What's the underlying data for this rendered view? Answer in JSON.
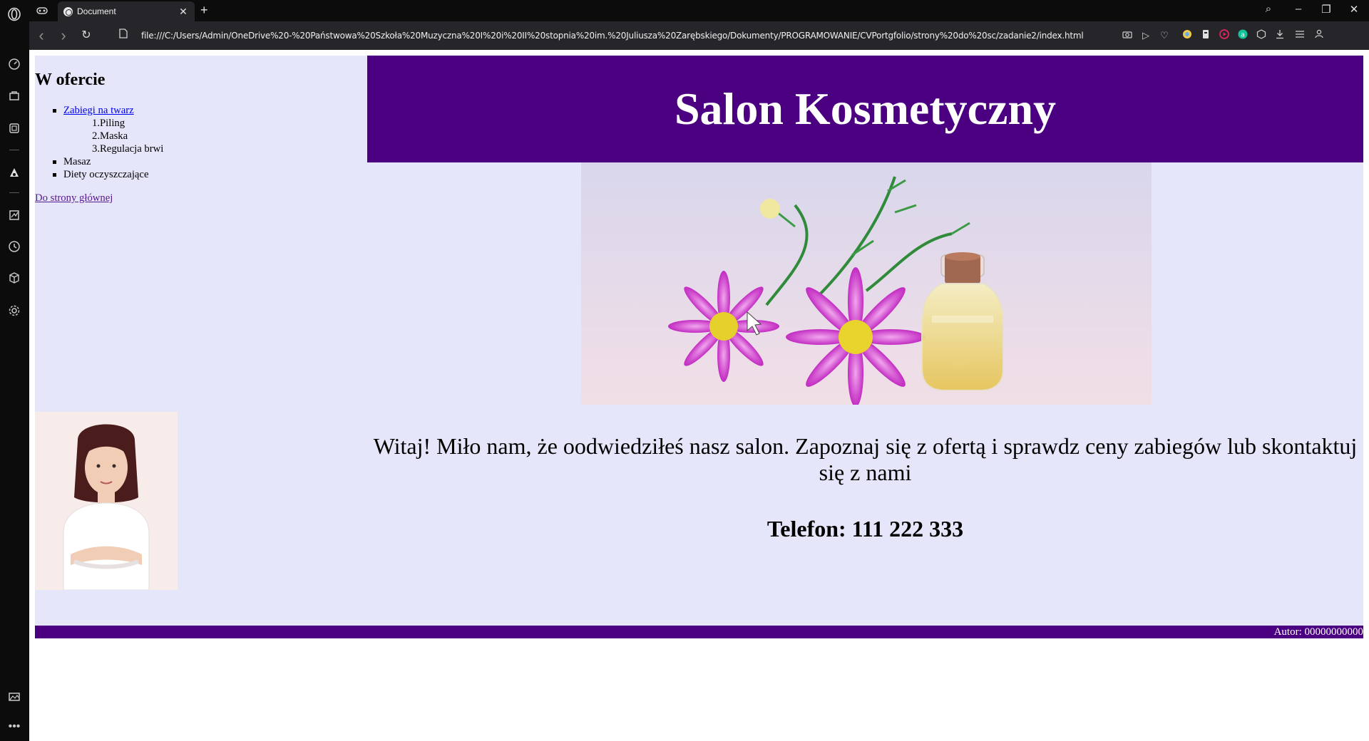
{
  "browser": {
    "tab_title": "Document",
    "tab_close": "✕",
    "new_tab": "+",
    "url": "file:///C:/Users/Admin/OneDrive%20-%20Państwowa%20Szkoła%20Muzyczna%20I%20i%20II%20stopnia%20im.%20Juliusza%20Zarębskiego/Dokumenty/PROGRAMOWANIE/CVPortgfolio/strony%20do%20sc/zadanie2/index.html",
    "back": "‹",
    "forward": "›",
    "reload": "↻",
    "win_search": "⌕",
    "win_minimize": "–",
    "win_restore": "❐",
    "win_close": "✕"
  },
  "colors": {
    "page_bg": "#e6e6fa",
    "header_bg": "#4b0082",
    "footer_bg": "#4b0082",
    "link": "#0000ee",
    "visited_link": "#551a8b"
  },
  "aside": {
    "heading": "W ofercie",
    "items": [
      {
        "label": "Zabiegi na twarz",
        "link": true
      },
      {
        "label": "Masaz",
        "link": false
      },
      {
        "label": "Diety oczyszczające",
        "link": false
      }
    ],
    "subitems": [
      "1.Piling",
      "2.Maska",
      "3.Regulacja brwi"
    ],
    "home_link": "Do strony głównej"
  },
  "header": {
    "title": "Salon Kosmetyczny"
  },
  "main": {
    "welcome": "Witaj! Miło nam, że oodwiedziłeś nasz salon. Zapoznaj się z ofertą i sprawdz ceny zabiegów lub skontaktuj się z nami",
    "phone": "Telefon: 111 222 333"
  },
  "footer": {
    "author": "Autor: 00000000000"
  }
}
